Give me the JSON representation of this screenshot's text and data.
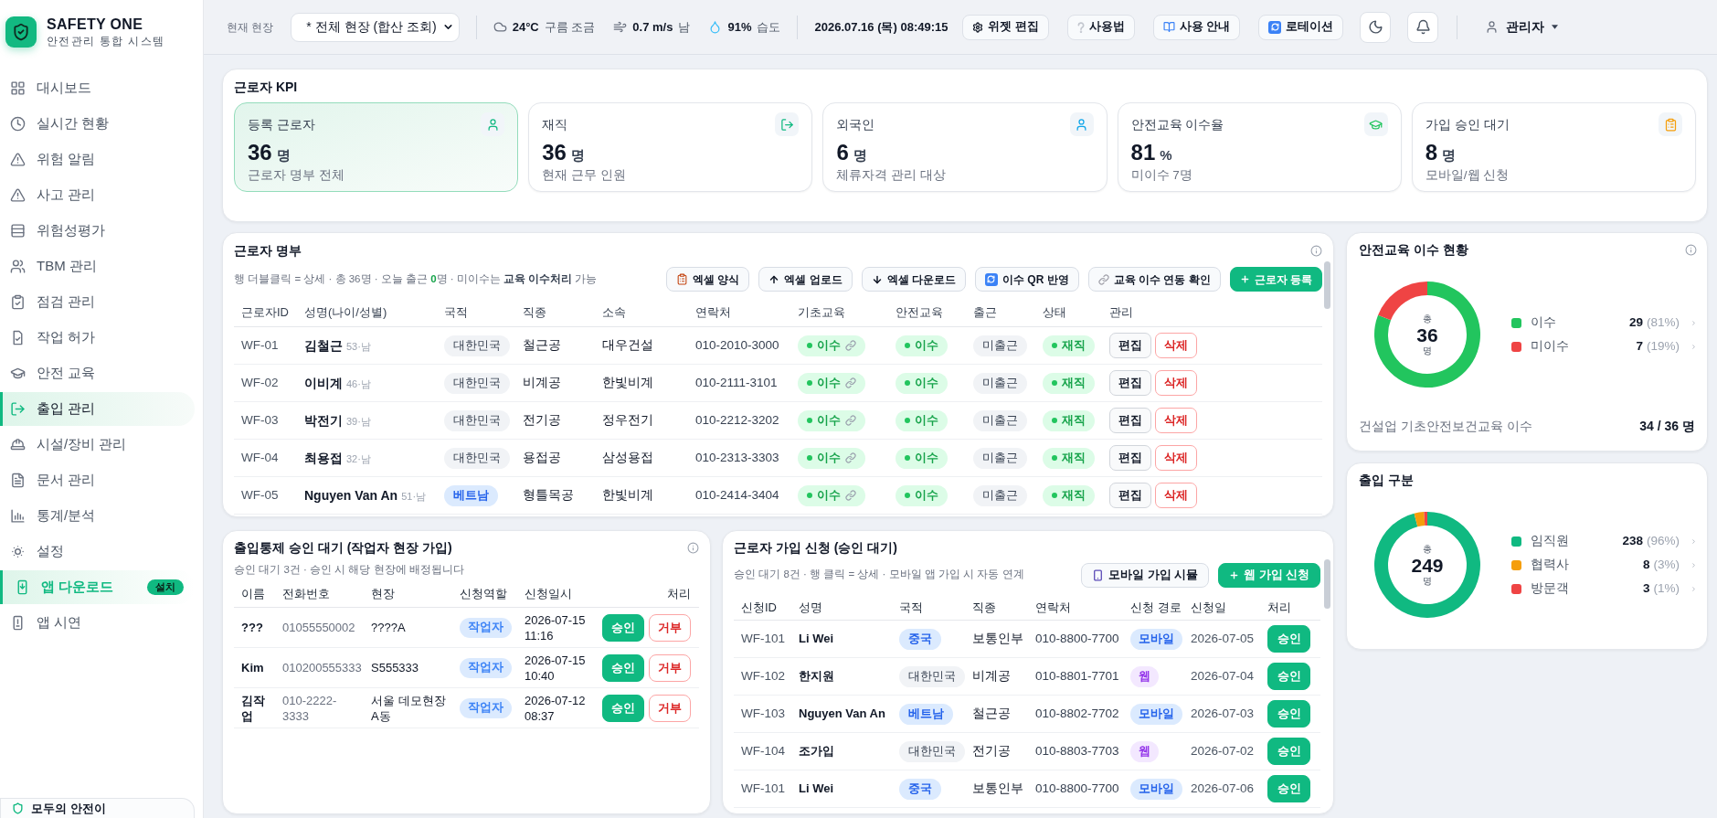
{
  "sidebar": {
    "brand": {
      "title": "SAFETY ONE",
      "subtitle": "안전관리 통합 시스템"
    },
    "items": [
      {
        "label": "대시보드",
        "kind": "link",
        "selected": false
      },
      {
        "label": "실시간 현황",
        "kind": "link",
        "selected": false
      },
      {
        "label": "위험 알림",
        "kind": "link",
        "selected": false
      },
      {
        "label": "사고 관리",
        "kind": "link",
        "selected": false
      },
      {
        "label": "위험성평가",
        "kind": "link",
        "selected": false
      },
      {
        "label": "TBM 관리",
        "kind": "link",
        "selected": false
      },
      {
        "label": "점검 관리",
        "kind": "link",
        "selected": false
      },
      {
        "label": "작업 허가",
        "kind": "link",
        "selected": false
      },
      {
        "label": "안전 교육",
        "kind": "link",
        "selected": false
      },
      {
        "label": "출입 관리",
        "kind": "link",
        "selected": true
      },
      {
        "label": "시설/장비 관리",
        "kind": "link",
        "selected": false
      },
      {
        "label": "문서 관리",
        "kind": "link",
        "selected": false
      },
      {
        "label": "통계/분석",
        "kind": "link",
        "selected": false
      },
      {
        "label": "설정",
        "kind": "link",
        "selected": false
      },
      {
        "label": "앱 다운로드",
        "kind": "promo",
        "selected": false,
        "badge": "설치"
      },
      {
        "label": "앱 시연",
        "kind": "link",
        "selected": false
      }
    ],
    "footer": "모두의 안전이"
  },
  "header": {
    "site_label": "현재 현장",
    "site_value": "* 전체 현장 (합산 조회)",
    "weather": [
      {
        "value": "24°C",
        "text": "구름 조금"
      },
      {
        "value": "0.7 m/s",
        "text": "남"
      },
      {
        "value": "91%",
        "text": "습도"
      }
    ],
    "datetime": "2026.07.16 (목) 08:49:15",
    "buttons": [
      "위젯 편집",
      "사용법",
      "사용 안내",
      "로테이션"
    ],
    "user": "관리자"
  },
  "kpi": {
    "title": "근로자 KPI",
    "cards": [
      {
        "label": "등록 근로자",
        "value": "36",
        "unit": "명",
        "caption": "근로자 명부 전체",
        "selected": true
      },
      {
        "label": "재직",
        "value": "36",
        "unit": "명",
        "caption": "현재 근무 인원",
        "selected": false
      },
      {
        "label": "외국인",
        "value": "6",
        "unit": "명",
        "caption": "체류자격 관리 대상",
        "selected": false
      },
      {
        "label": "안전교육 이수율",
        "value": "81",
        "unit": "%",
        "caption": "미이수 7명",
        "selected": false
      },
      {
        "label": "가입 승인 대기",
        "value": "8",
        "unit": "명",
        "caption": "모바일/웹 신청",
        "selected": false
      }
    ]
  },
  "roster": {
    "title": "근로자 명부",
    "subtitle": {
      "before": "행 더블클릭 = 상세 · 총 36명 · 오늘 출근 ",
      "count": "0",
      "after": "명 · 미이수는 **교육 이수처리** 가능"
    },
    "buttons": [
      {
        "label": "엑셀 양식",
        "kind": "default"
      },
      {
        "label": "엑셀 업로드",
        "kind": "default"
      },
      {
        "label": "엑셀 다운로드",
        "kind": "default"
      },
      {
        "label": "이수 QR 반영",
        "kind": "default"
      },
      {
        "label": "교육 이수 연동 확인",
        "kind": "default"
      },
      {
        "label": "근로자 등록",
        "kind": "primary"
      }
    ],
    "columns": [
      "근로자ID",
      "성명(나이/성별)",
      "국적",
      "직종",
      "소속",
      "연락처",
      "기초교육",
      "안전교육",
      "출근",
      "상태",
      "관리"
    ],
    "rows": [
      {
        "id": "WF-01",
        "name": "김철근",
        "meta": "53·남",
        "nationality": {
          "label": "대한민국",
          "foreign": false
        },
        "trade": "철근공",
        "company": "대우건설",
        "phone": "010-2010-3000",
        "basic_edu": {
          "label": "이수",
          "linked": true
        },
        "safety_edu": "이수",
        "attendance": "미출근",
        "status": "재직",
        "actions": [
          "편집",
          "삭제"
        ]
      },
      {
        "id": "WF-02",
        "name": "이비계",
        "meta": "46·남",
        "nationality": {
          "label": "대한민국",
          "foreign": false
        },
        "trade": "비계공",
        "company": "한빛비계",
        "phone": "010-2111-3101",
        "basic_edu": {
          "label": "이수",
          "linked": true
        },
        "safety_edu": "이수",
        "attendance": "미출근",
        "status": "재직",
        "actions": [
          "편집",
          "삭제"
        ]
      },
      {
        "id": "WF-03",
        "name": "박전기",
        "meta": "39·남",
        "nationality": {
          "label": "대한민국",
          "foreign": false
        },
        "trade": "전기공",
        "company": "정우전기",
        "phone": "010-2212-3202",
        "basic_edu": {
          "label": "이수",
          "linked": true
        },
        "safety_edu": "이수",
        "attendance": "미출근",
        "status": "재직",
        "actions": [
          "편집",
          "삭제"
        ]
      },
      {
        "id": "WF-04",
        "name": "최용접",
        "meta": "32·남",
        "nationality": {
          "label": "대한민국",
          "foreign": false
        },
        "trade": "용접공",
        "company": "삼성용접",
        "phone": "010-2313-3303",
        "basic_edu": {
          "label": "이수",
          "linked": true
        },
        "safety_edu": "이수",
        "attendance": "미출근",
        "status": "재직",
        "actions": [
          "편집",
          "삭제"
        ]
      },
      {
        "id": "WF-05",
        "name": "Nguyen Van An",
        "meta": "51·남",
        "nationality": {
          "label": "베트남",
          "foreign": true
        },
        "trade": "형틀목공",
        "company": "한빛비계",
        "phone": "010-2414-3404",
        "basic_edu": {
          "label": "이수",
          "linked": true
        },
        "safety_edu": "이수",
        "attendance": "미출근",
        "status": "재직",
        "actions": [
          "편집",
          "삭제"
        ]
      }
    ]
  },
  "education": {
    "title": "안전교육 이수 현황",
    "center": {
      "label": "총",
      "total": "36",
      "unit": "명"
    },
    "chart_data": {
      "type": "donut",
      "categories": [
        "이수",
        "미이수"
      ],
      "series": [
        {
          "values": [
            81,
            19
          ]
        }
      ]
    },
    "legend": [
      {
        "color": "#22c55e",
        "count": "29",
        "percent": "(81%)"
      },
      {
        "color": "#ef4444",
        "count": "7",
        "percent": "(19%)"
      }
    ],
    "footer": {
      "label": "건설업 기초안전보건교육 이수",
      "value": "34 / 36 명"
    }
  },
  "access_types": {
    "title": "출입 구분",
    "center": {
      "label": "총",
      "total": "249",
      "unit": "명"
    },
    "chart_data": {
      "type": "donut",
      "categories": [
        "임직원",
        "협력사",
        "방문객"
      ],
      "series": [
        {
          "values": [
            96,
            3,
            1
          ]
        }
      ]
    },
    "legend": [
      {
        "color": "#10b981",
        "count": "238",
        "percent": "(96%)"
      },
      {
        "color": "#f59e0b",
        "count": "8",
        "percent": "(3%)"
      },
      {
        "color": "#ef4444",
        "count": "3",
        "percent": "(1%)"
      }
    ]
  },
  "access_approvals": {
    "title": "출입통제 승인 대기 (작업자 현장 가입)",
    "subtitle": "승인 대기 3건 · 승인 시 해당 현장에 배정됩니다",
    "columns": [
      "이름",
      "전화번호",
      "현장",
      "신청역할",
      "신청일시",
      "처리"
    ],
    "rows": [
      {
        "name": "???",
        "phone": "01055550002",
        "site": "????A",
        "role": "작업자",
        "requested": "2026-07-15 11:16",
        "actions": [
          "승인",
          "거부"
        ]
      },
      {
        "name": "Kim",
        "phone": "010200555333",
        "site": "S555333",
        "role": "작업자",
        "requested": "2026-07-15 10:40",
        "actions": [
          "승인",
          "거부"
        ]
      },
      {
        "name": "김작업",
        "phone": "010-2222-3333",
        "site": "서울 데모현장 A동",
        "role": "작업자",
        "requested": "2026-07-12 08:37",
        "actions": [
          "승인",
          "거부"
        ]
      }
    ]
  },
  "signup_requests": {
    "title": "근로자 가입 신청 (승인 대기)",
    "subtitle": "승인 대기 8건 · 행 클릭 = 상세 · 모바일 앱 가입 시 자동 연계",
    "buttons": [
      {
        "label": "모바일 가입 시뮬",
        "kind": "default"
      },
      {
        "label": "웹 가입 신청",
        "kind": "primary"
      }
    ],
    "columns": [
      "신청ID",
      "성명",
      "국적",
      "직종",
      "연락처",
      "신청 경로",
      "신청일",
      "처리"
    ],
    "rows": [
      {
        "id": "WF-101",
        "name": "Li Wei",
        "nationality": {
          "label": "중국",
          "foreign": true
        },
        "trade": "보통인부",
        "phone": "010-8800-7700",
        "route": {
          "label": "모바일",
          "kind": "mobile"
        },
        "date": "2026-07-05",
        "actions": [
          "승인"
        ]
      },
      {
        "id": "WF-102",
        "name": "한지원",
        "nationality": {
          "label": "대한민국",
          "foreign": false
        },
        "trade": "비계공",
        "phone": "010-8801-7701",
        "route": {
          "label": "웹",
          "kind": "web"
        },
        "date": "2026-07-04",
        "actions": [
          "승인"
        ]
      },
      {
        "id": "WF-103",
        "name": "Nguyen Van An",
        "nationality": {
          "label": "베트남",
          "foreign": true
        },
        "trade": "철근공",
        "phone": "010-8802-7702",
        "route": {
          "label": "모바일",
          "kind": "mobile"
        },
        "date": "2026-07-03",
        "actions": [
          "승인"
        ]
      },
      {
        "id": "WF-104",
        "name": "조가입",
        "nationality": {
          "label": "대한민국",
          "foreign": false
        },
        "trade": "전기공",
        "phone": "010-8803-7703",
        "route": {
          "label": "웹",
          "kind": "web"
        },
        "date": "2026-07-02",
        "actions": [
          "승인"
        ]
      },
      {
        "id": "WF-101",
        "name": "Li Wei",
        "nationality": {
          "label": "중국",
          "foreign": true
        },
        "trade": "보통인부",
        "phone": "010-8800-7700",
        "route": {
          "label": "모바일",
          "kind": "mobile"
        },
        "date": "2026-07-06",
        "actions": [
          "승인"
        ]
      }
    ]
  }
}
